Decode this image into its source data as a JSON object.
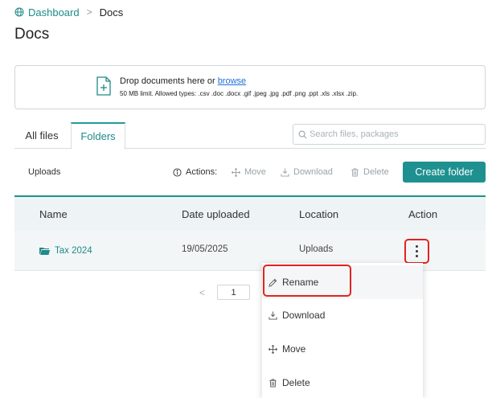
{
  "breadcrumb": {
    "root": "Dashboard",
    "separator": ">",
    "current": "Docs"
  },
  "page": {
    "title": "Docs"
  },
  "upload": {
    "prompt": "Drop documents here or",
    "browse_link": "browse",
    "limits": "50 MB limit. Allowed types: .csv .doc .docx .gif .jpeg .jpg .pdf .png .ppt .xls .xlsx .zip."
  },
  "tabs": [
    {
      "label": "All files",
      "active": false
    },
    {
      "label": "Folders",
      "active": true
    }
  ],
  "search": {
    "placeholder": "Search files, packages",
    "value": ""
  },
  "toolbar": {
    "path": "Uploads",
    "actions_label": "Actions:",
    "move": "Move",
    "download": "Download",
    "delete": "Delete",
    "create_folder": "Create folder"
  },
  "table": {
    "headers": [
      "Name",
      "Date uploaded",
      "Location",
      "Action"
    ],
    "rows": [
      {
        "name": "Tax 2024",
        "date": "19/05/2025",
        "location": "Uploads"
      }
    ]
  },
  "pagination": {
    "prev": "<",
    "current_page": "1"
  },
  "context_menu": {
    "items": [
      {
        "label": "Rename",
        "icon": "pencil-icon"
      },
      {
        "label": "Download",
        "icon": "download-icon"
      },
      {
        "label": "Move",
        "icon": "move-icon"
      },
      {
        "label": "Delete",
        "icon": "trash-icon"
      }
    ]
  },
  "colors": {
    "accent": "#1f9090",
    "link": "#1f6fd6",
    "highlight": "#e32222"
  }
}
